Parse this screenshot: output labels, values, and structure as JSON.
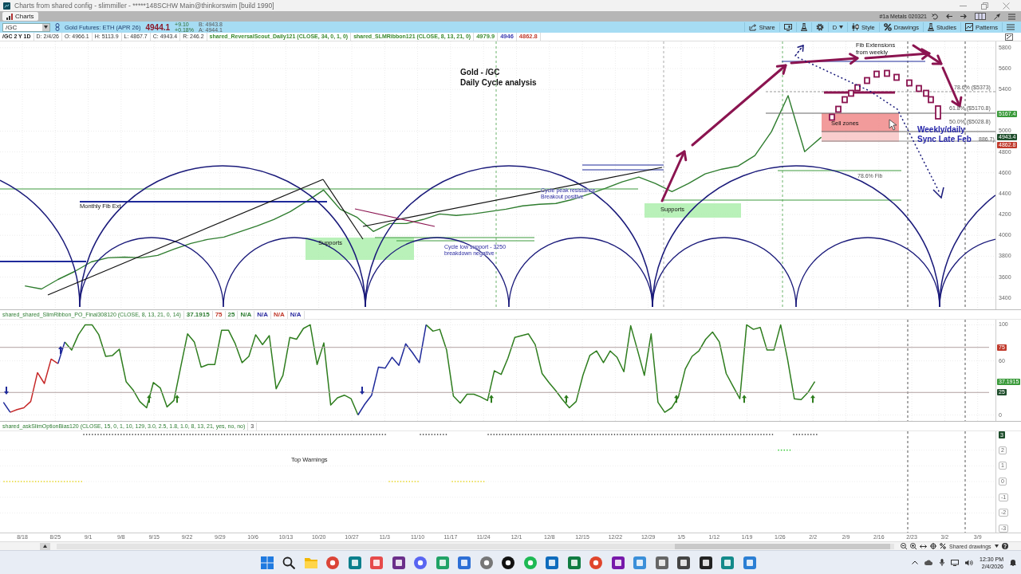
{
  "window": {
    "title": "Charts from shared config - slimmiller - *****148SCHW Main@thinkorswim [build 1990]"
  },
  "tab_bar": {
    "tabs": [
      {
        "label": "Charts",
        "selected": true
      }
    ],
    "layout_name": "#1a Metals 020321"
  },
  "symbol_bar": {
    "symbol": "/GC",
    "description": "Gold Futures: ETH (APR 26)",
    "last": "4944.1",
    "change": "+9.10",
    "change_percent": "+0.18%",
    "bid": "B: 4943.8",
    "ask": "A: 4944.1",
    "tools": [
      {
        "kind": "share",
        "label": "Share"
      },
      {
        "kind": "screen"
      },
      {
        "kind": "flask"
      },
      {
        "kind": "gear"
      },
      {
        "kind": "aggregation",
        "label": "D"
      },
      {
        "kind": "style",
        "label": "Style"
      },
      {
        "kind": "drawings",
        "label": "Drawings"
      },
      {
        "kind": "studies",
        "label": "Studies"
      },
      {
        "kind": "patterns",
        "label": "Patterns"
      },
      {
        "kind": "menu"
      }
    ]
  },
  "info_row": {
    "chart_label": "/GC 2 Y 1D",
    "items": [
      {
        "kind": "quote",
        "text": "D: 2/4/26"
      },
      {
        "kind": "quote",
        "text": "O: 4966.1"
      },
      {
        "kind": "quote",
        "text": "H: 5113.9"
      },
      {
        "kind": "quote",
        "text": "L: 4867.7"
      },
      {
        "kind": "quote",
        "text": "C: 4943.4"
      },
      {
        "kind": "quote",
        "text": "R: 246.2"
      },
      {
        "kind": "study",
        "text": "shared_ReversalScout_Daily121 (CLOSE, 34, 0, 1, 0)",
        "color": "#3b8a2e"
      },
      {
        "kind": "study",
        "text": "shared_SLMRibbon121 (CLOSE, 8, 13, 21, 0)",
        "color": "#3b8a2e"
      },
      {
        "kind": "value",
        "text": "4979.9",
        "color": "#3b8a2e"
      },
      {
        "kind": "value",
        "text": "4946",
        "color": "#3a3ab0"
      },
      {
        "kind": "value",
        "text": "4862.8",
        "color": "#c0392b"
      }
    ]
  },
  "price_chart": {
    "chart_data": {
      "type": "line",
      "grid": true,
      "categories": [
        null,
        null,
        null,
        null,
        null,
        null,
        null,
        null,
        null,
        null,
        null,
        null,
        null,
        null,
        null,
        null,
        null,
        null,
        null,
        null,
        null,
        null,
        null,
        null,
        null,
        null,
        null,
        null,
        null,
        null,
        null,
        null,
        null,
        null,
        null,
        null,
        null,
        null,
        null,
        null,
        null,
        null,
        null,
        null,
        null,
        null,
        null,
        null,
        null,
        null,
        null,
        null,
        null,
        null,
        null,
        null,
        null,
        null,
        null,
        null
      ],
      "series": [
        {
          "color": "#2f7d2f",
          "values": [
            null,
            3515,
            3485,
            3577,
            3653,
            3745,
            3784,
            3791,
            3784,
            3807,
            3868,
            3922,
            3960,
            3983,
            4037,
            4090,
            4152,
            4228,
            4328,
            4435,
            4251,
            4175,
            4037,
            4113,
            4113,
            4152,
            4205,
            4190,
            4205,
            4228,
            4251,
            4282,
            4297,
            4305,
            4343,
            4397,
            4451,
            4512,
            4558,
            4497,
            4420,
            4497,
            4589,
            4635,
            4665,
            4765,
            4995,
            5340,
            4803,
            4941,
            null,
            null,
            null,
            null,
            null,
            null,
            null,
            null,
            null,
            null
          ]
        }
      ],
      "ylim": [
        3290,
        5860
      ],
      "yticks": [
        3400,
        3600,
        3800,
        4000,
        4200,
        4400,
        4600,
        4800,
        5000,
        5400,
        5600,
        5800
      ]
    },
    "drawing_labels": [
      {
        "kind": "heading",
        "text": "Gold - /GC\nDaily Cycle analysis"
      },
      {
        "kind": "label",
        "text": "Monthly Fib Ext"
      },
      {
        "kind": "label",
        "text": "Supports"
      },
      {
        "kind": "note",
        "text": "Cycle peak resistance\nBreakout positive"
      },
      {
        "kind": "note",
        "text": "Cycle low support - 3250\nbreakdown negative"
      },
      {
        "kind": "label",
        "text": "Supports"
      },
      {
        "kind": "label",
        "text": "Fib Extensions\nfrom weekly"
      },
      {
        "kind": "label",
        "text": "Sell zones"
      },
      {
        "kind": "fib",
        "text": "78.6% Fib"
      },
      {
        "kind": "fib",
        "text": "78.6% ($5373)"
      },
      {
        "kind": "fib",
        "text": "61.8% ($5170.8)"
      },
      {
        "kind": "fib",
        "text": "50.0% ($5028.8)"
      },
      {
        "kind": "emphasis",
        "text": "Weekly/daily\nSync Late Feb"
      },
      {
        "kind": "fib",
        "text": "886.7)"
      }
    ],
    "axis_tags": [
      {
        "text": "5167.4",
        "color": "#3a9a3a"
      },
      {
        "text": "4943.4",
        "color": "#1e4d2b"
      },
      {
        "text": "4862.8",
        "color": "#c0392b"
      }
    ]
  },
  "oscillator": {
    "study": "shared_shared_SlimRibbon_PO_Final308120 (CLOSE, 8, 13, 21, 0, 14)",
    "readings": [
      {
        "text": "37.1915",
        "color": "#2e7d32"
      },
      {
        "text": "75",
        "color": "#c0392b"
      },
      {
        "text": "25",
        "color": "#2e7d32"
      },
      {
        "text": "N/A",
        "color": "#2e7d32"
      },
      {
        "text": "N/A",
        "color": "#2c2ca0"
      },
      {
        "text": "N/A",
        "color": "#c0392b"
      },
      {
        "text": "N/A",
        "color": "#2c2ca0"
      }
    ],
    "chart_data": {
      "type": "line",
      "grid": true,
      "categories": [
        null,
        null,
        null,
        null,
        null,
        null,
        null,
        null,
        null,
        null,
        null,
        null,
        null,
        null,
        null,
        null,
        null,
        null,
        null,
        null,
        null,
        null,
        null,
        null,
        null,
        null,
        null,
        null,
        null,
        null,
        null,
        null,
        null,
        null,
        null,
        null,
        null,
        null,
        null,
        null,
        null,
        null,
        null,
        null,
        null,
        null,
        null,
        null,
        null,
        null,
        null,
        null,
        null,
        null,
        null,
        null,
        null,
        null,
        null,
        null,
        null,
        null,
        null,
        null,
        null,
        null,
        null,
        null,
        null,
        null,
        null,
        null,
        null,
        null,
        null,
        null,
        null,
        null,
        null,
        null,
        null,
        null,
        null,
        null,
        null,
        null,
        null,
        null,
        null,
        null,
        null,
        null,
        null,
        null,
        null,
        null,
        null,
        null,
        null,
        null,
        null,
        null,
        null,
        null,
        null,
        null,
        null,
        null,
        null,
        null,
        null,
        null,
        null,
        null,
        null,
        null,
        null,
        null,
        null,
        null,
        null,
        null,
        null,
        null,
        null,
        null,
        null,
        null,
        null,
        null,
        null,
        null,
        null,
        null,
        null,
        null,
        null,
        null,
        null,
        null,
        null,
        null,
        null,
        null,
        null,
        null
      ],
      "series": [
        {
          "color": "#2e7d1e",
          "values": [
            null,
            null,
            null,
            null,
            null,
            null,
            null,
            null,
            null,
            81,
            72,
            89,
            100,
            100,
            89,
            65,
            66,
            73,
            37,
            28,
            15,
            8,
            36,
            30,
            9,
            16,
            53,
            90,
            81,
            53,
            56,
            56,
            94,
            94,
            79,
            58,
            65,
            89,
            78,
            88,
            29,
            44,
            86,
            84,
            96,
            100,
            56,
            80,
            11,
            19,
            22,
            18,
            0,
            null,
            null,
            null,
            null,
            null,
            null,
            null,
            null,
            null,
            100,
            93,
            95,
            72,
            21,
            13,
            23,
            23,
            20,
            16,
            49,
            45,
            63,
            86,
            88,
            90,
            78,
            46,
            36,
            27,
            17,
            8,
            15,
            44,
            66,
            71,
            58,
            71,
            64,
            48,
            99,
            72,
            44,
            90,
            14,
            3,
            8,
            20,
            51,
            65,
            71,
            84,
            92,
            81,
            46,
            32,
            18,
            100,
            95,
            97,
            72,
            72,
            100,
            62,
            18,
            17,
            25,
            37,
            null,
            null,
            null,
            null,
            null,
            null,
            null,
            null,
            null,
            null,
            null,
            null,
            null,
            null,
            null,
            null,
            null,
            null,
            null,
            null,
            null,
            null,
            null,
            null,
            null,
            null
          ]
        },
        {
          "color": "#c62828",
          "values": [
            null,
            3,
            6,
            8,
            15,
            47,
            35,
            62,
            57,
            null,
            null,
            null,
            null,
            null,
            null,
            null,
            null,
            null,
            null,
            null,
            null,
            null,
            null,
            null,
            null,
            null,
            null,
            null,
            null,
            null,
            null,
            null,
            null,
            null,
            null,
            null,
            null,
            null,
            null,
            null,
            null,
            null,
            null,
            null,
            null,
            null,
            null,
            null,
            null,
            null,
            null,
            null,
            null,
            null,
            null,
            null,
            null,
            null,
            null,
            null,
            null,
            null,
            null,
            null,
            null,
            null,
            null,
            null,
            null,
            null,
            null,
            null,
            null,
            null,
            null,
            null,
            null,
            null,
            null,
            null,
            null,
            null,
            null,
            null,
            null,
            null,
            null,
            null,
            null,
            null,
            null,
            null,
            null,
            null,
            null,
            null,
            null,
            null,
            null,
            null,
            null,
            null,
            null,
            null,
            null,
            null,
            null,
            null,
            null,
            null,
            null,
            null,
            null,
            null,
            null,
            null,
            null,
            null,
            null,
            null,
            null,
            null,
            null,
            null,
            null,
            null,
            null,
            null,
            null,
            null,
            null,
            null,
            null,
            null,
            null,
            null,
            null,
            null,
            null,
            null,
            null,
            null,
            null,
            null,
            null,
            null
          ]
        },
        {
          "color": "#1f2a9a",
          "values": [
            14,
            3,
            null,
            null,
            null,
            null,
            null,
            null,
            57,
            81,
            null,
            null,
            null,
            null,
            null,
            null,
            null,
            null,
            null,
            null,
            null,
            null,
            null,
            null,
            null,
            null,
            null,
            null,
            null,
            null,
            null,
            null,
            null,
            null,
            null,
            null,
            null,
            null,
            null,
            null,
            null,
            null,
            null,
            null,
            null,
            null,
            null,
            null,
            null,
            null,
            null,
            null,
            0,
            12,
            22,
            53,
            52,
            64,
            55,
            79,
            69,
            58,
            100,
            null,
            null,
            null,
            null,
            null,
            null,
            null,
            null,
            null,
            null,
            null,
            null,
            null,
            null,
            null,
            null,
            null,
            null,
            null,
            null,
            null,
            null,
            null,
            null,
            null,
            null,
            null,
            null,
            null,
            null,
            null,
            null,
            null,
            null,
            null,
            null,
            null,
            null,
            null,
            null,
            null,
            null,
            null,
            null,
            null,
            null,
            null,
            null,
            null,
            null,
            null,
            null,
            null,
            null,
            null,
            null,
            null,
            null,
            null,
            null,
            null,
            null,
            null,
            null,
            null,
            null,
            null,
            null,
            null,
            null,
            null,
            null,
            null,
            null,
            null,
            null,
            null,
            null,
            null,
            null,
            null,
            null,
            null
          ]
        }
      ],
      "ylim": [
        -6.6,
        105.7
      ],
      "yticks": [
        0,
        60,
        100
      ]
    },
    "levels": [
      {
        "text": "75",
        "color": "#c0392b"
      },
      {
        "text": "25",
        "color": "#1e4d2b"
      }
    ],
    "axis_tags": [
      {
        "text": "37.1915",
        "color": "#3a9a3a"
      }
    ]
  },
  "option_bias": {
    "study": "shared_askSlimOptionBias120 (CLOSE, 15, 0, 1, 10, 129, 3.0, 2.5, 1.8, 1.0, 8, 13, 21, yes, no, no)",
    "reading": "3",
    "badge": "3",
    "axis_labels": [
      "2",
      "1",
      "0",
      "-1",
      "-2",
      "-3"
    ],
    "label": "Top Warnings"
  },
  "time_axis": {
    "labels": [
      "8/18",
      "8/25",
      "9/1",
      "9/8",
      "9/15",
      "9/22",
      "9/29",
      "10/6",
      "10/13",
      "10/20",
      "10/27",
      "11/3",
      "11/10",
      "11/17",
      "11/24",
      "12/1",
      "12/8",
      "12/15",
      "12/22",
      "12/29",
      "1/5",
      "1/12",
      "1/19",
      "1/26",
      "2/2",
      "2/9",
      "2/16",
      "2/23",
      "3/2",
      "3/9"
    ]
  },
  "status_bar": {
    "shared_drawings": "Shared drawings"
  },
  "taskbar": {
    "time": "12:30 PM",
    "date": "2/4/2026"
  }
}
